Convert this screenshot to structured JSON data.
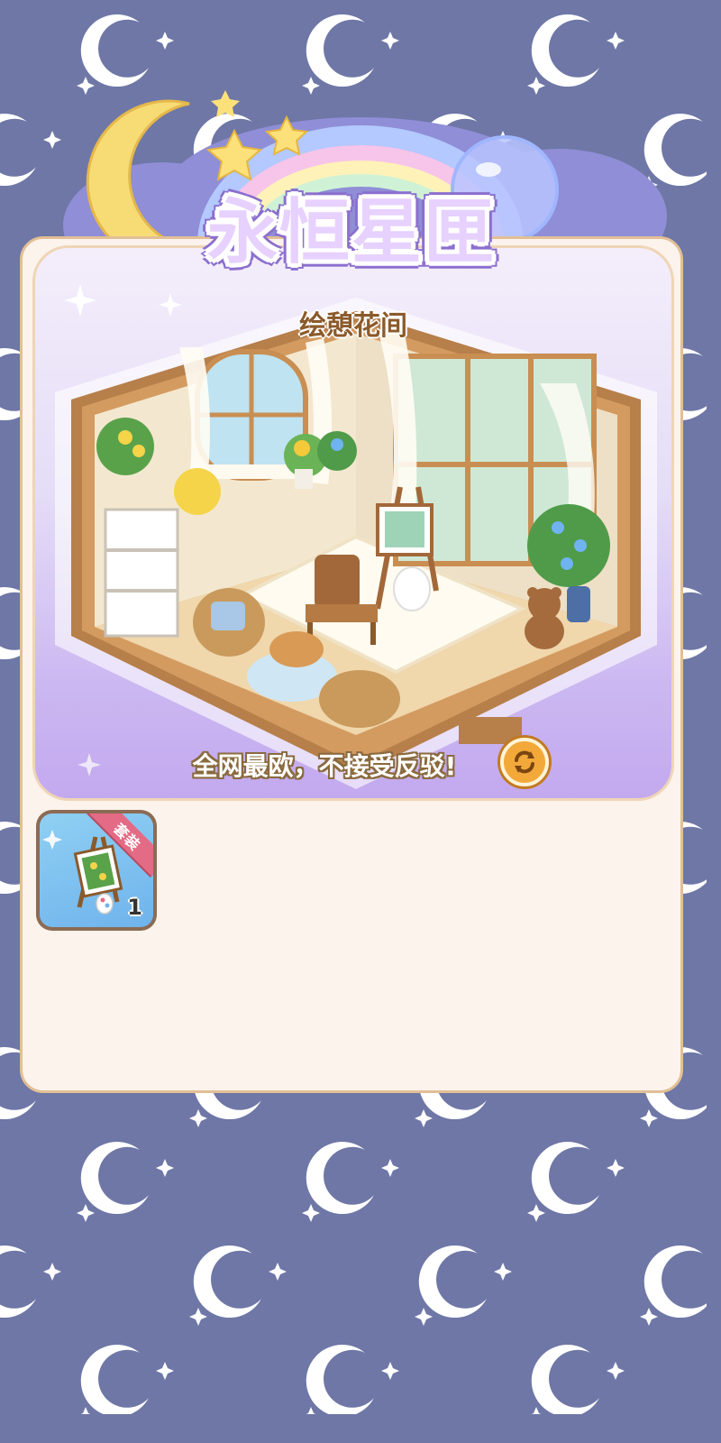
{
  "game": {
    "title": "永恒星匣",
    "room_name": "绘憩花间",
    "slogan": "全网最欧，不接受反驳!",
    "refresh_icon": "refresh-icon"
  },
  "items": [
    {
      "name": "easel-item",
      "tag": "套装",
      "count": "1",
      "icon": "easel-icon"
    }
  ],
  "colors": {
    "background": "#6e77a6",
    "panel": "#fbf3ec",
    "panel_border": "#e2bf95",
    "title_fill": "#e7d1ff",
    "title_outline": "#8b6fce",
    "room_name": "#8b5a2b",
    "refresh_button": "#f3a93a",
    "item_tag": "#e46b85"
  }
}
